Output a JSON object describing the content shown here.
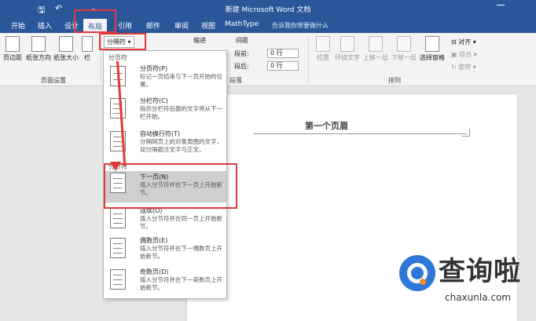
{
  "window": {
    "title": "新建 Microsoft Word 文档",
    "qa_save": "🖫",
    "qa_undo": "↶",
    "qa_more": "₌"
  },
  "tabs": [
    "开始",
    "插入",
    "设计",
    "布局",
    "引用",
    "邮件",
    "审阅",
    "视图",
    "MathType"
  ],
  "tell_me": "告诉我你想要做什么",
  "ribbon": {
    "margins": "页边距",
    "orientation": "纸张方向",
    "size": "纸张大小",
    "columns": "栏",
    "breaks_button": "分隔符",
    "indent": "缩进",
    "spacing": "间距",
    "before_label": "段前:",
    "before_value": "0 行",
    "after_label": "段后:",
    "after_value": "0 行",
    "paragraph_group": "段落",
    "page_setup_group": "页面设置",
    "position": "位置",
    "wrap_text": "环绕文字",
    "bring_forward": "上移一层",
    "send_backward": "下移一层",
    "selection_pane": "选择窗格",
    "align": "对齐",
    "group": "组合",
    "rotate": "旋转",
    "arrange_group": "排列"
  },
  "document": {
    "header_text": "第一个页眉"
  },
  "dropdown": {
    "page_breaks_heading": "分页符",
    "section_breaks_heading": "分节符",
    "items": [
      {
        "title": "分页符(P)",
        "desc": "标记一页结束与下一页开始的位置。"
      },
      {
        "title": "分栏符(C)",
        "desc": "指示分栏符后面的文字将从下一栏开始。"
      },
      {
        "title": "自动换行符(T)",
        "desc": "分隔网页上的对象周围的文字，如分隔题注文字与正文。"
      },
      {
        "title": "下一页(N)",
        "desc": "插入分节符并在下一页上开始新节。"
      },
      {
        "title": "连续(O)",
        "desc": "插入分节符并在同一页上开始新节。"
      },
      {
        "title": "偶数页(E)",
        "desc": "插入分节符并在下一偶数页上开始新节。"
      },
      {
        "title": "奇数页(D)",
        "desc": "插入分节符并在下一奇数页上开始新节。"
      }
    ]
  },
  "watermark": {
    "name": "查询啦",
    "url": "chaxunla.com"
  },
  "colors": {
    "title_bar": "#2b579a",
    "annotation_red": "#e03a3a",
    "watermark_blue": "#2f78d8",
    "watermark_orange": "#f28c28"
  }
}
